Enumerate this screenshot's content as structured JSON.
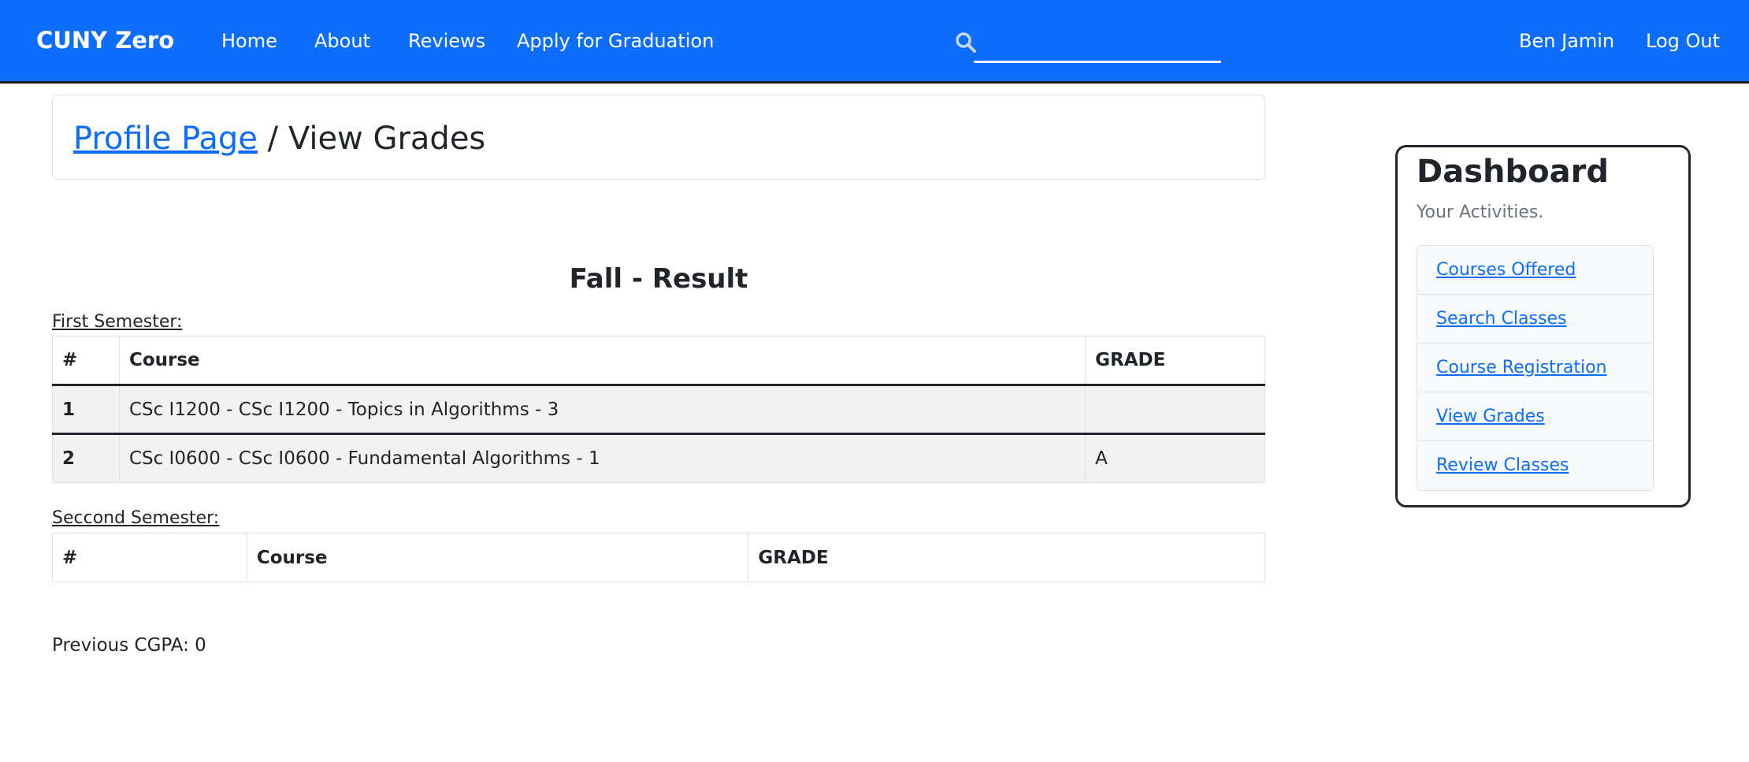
{
  "navbar": {
    "brand": "CUNY Zero",
    "links": [
      "Home",
      "About",
      "Reviews",
      "Apply for Graduation"
    ],
    "search": {
      "value": "",
      "placeholder": "",
      "icon": "search-icon"
    },
    "user_name": "Ben Jamin",
    "logout": "Log Out",
    "bg_color": "#0d6efd"
  },
  "breadcrumb": {
    "link": "Profile Page",
    "separator": " / ",
    "current": "View Grades"
  },
  "result": {
    "title": "Fall - Result",
    "first_semester": {
      "label": "First Semester:",
      "headers": [
        "#",
        "Course",
        "GRADE"
      ],
      "rows": [
        {
          "num": "1",
          "course": "CSc I1200 - CSc I1200 - Topics in Algorithms - 3",
          "grade": ""
        },
        {
          "num": "2",
          "course": "CSc I0600 - CSc I0600 - Fundamental Algorithms - 1",
          "grade": "A"
        }
      ]
    },
    "second_semester": {
      "label": "Seccond Semester:",
      "headers": [
        "#",
        "Course",
        "GRADE"
      ],
      "rows": []
    },
    "cgpa": "Previous CGPA: 0"
  },
  "dashboard": {
    "title": "Dashboard",
    "subtitle": "Your Activities.",
    "items": [
      "Courses Offered",
      "Search Classes",
      "Course Registration",
      "View Grades",
      "Review Classes"
    ]
  }
}
